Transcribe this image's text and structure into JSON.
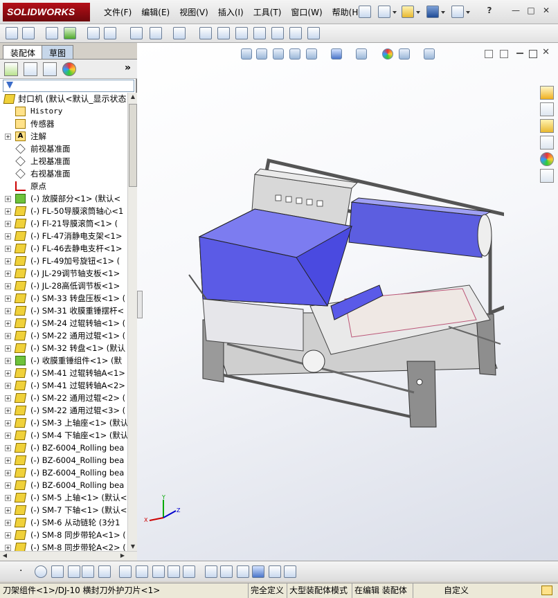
{
  "app": {
    "logo": "SOLIDWORKS",
    "brand_color": "#b50f18"
  },
  "menu": [
    "文件(F)",
    "编辑(E)",
    "视图(V)",
    "插入(I)",
    "工具(T)",
    "窗口(W)",
    "帮助(H)"
  ],
  "window_controls": {
    "help": "?",
    "minimize": "—",
    "restore": "□",
    "close": "✕"
  },
  "tabs": {
    "assembly": "装配体",
    "sketch": "草图"
  },
  "tree": {
    "root": "封口机 (默认<默认_显示状态",
    "items": [
      {
        "text": "History",
        "icon": "history-icon",
        "expand": false,
        "mono": true
      },
      {
        "text": "传感器",
        "icon": "sensor-icon",
        "expand": false
      },
      {
        "text": "注解",
        "icon": "annotation-icon",
        "expand": true
      },
      {
        "text": "前视基准面",
        "icon": "plane-icon",
        "expand": false
      },
      {
        "text": "上视基准面",
        "icon": "plane-icon",
        "expand": false
      },
      {
        "text": "右视基准面",
        "icon": "plane-icon",
        "expand": false
      },
      {
        "text": "原点",
        "icon": "origin-icon",
        "expand": false
      },
      {
        "text": "(-) 放膜部分<1> (默认<",
        "icon": "component-icon",
        "expand": true,
        "green": true
      },
      {
        "text": "(-) FL-50导膜滚筒轴心<1",
        "icon": "component-icon",
        "expand": true
      },
      {
        "text": "(-) Fl-21导膜滚筒<1> (",
        "icon": "component-icon",
        "expand": true
      },
      {
        "text": "(-) FL-47消静电支架<1>",
        "icon": "component-icon",
        "expand": true
      },
      {
        "text": "(-) FL-46去静电支杆<1>",
        "icon": "component-icon",
        "expand": true
      },
      {
        "text": "(-) FL-49加号旋钮<1> (",
        "icon": "component-icon",
        "expand": true
      },
      {
        "text": "(-) JL-29调节轴支板<1>",
        "icon": "component-icon",
        "expand": true
      },
      {
        "text": "(-) JL-28高低调节板<1>",
        "icon": "component-icon",
        "expand": true
      },
      {
        "text": "(-) SM-33 转盘压板<1> (",
        "icon": "component-icon",
        "expand": true
      },
      {
        "text": "(-) SM-31 收膜重锤摆杆<",
        "icon": "component-icon",
        "expand": true
      },
      {
        "text": "(-) SM-24 过辊转轴<1> (",
        "icon": "component-icon",
        "expand": true
      },
      {
        "text": "(-) SM-22 通用过辊<1> (",
        "icon": "component-icon",
        "expand": true
      },
      {
        "text": "(-) SM-32 转盘<1> (默认",
        "icon": "component-icon",
        "expand": true
      },
      {
        "text": "(-) 收膜重锤组件<1> (默",
        "icon": "component-icon",
        "expand": true,
        "green": true
      },
      {
        "text": "(-) SM-41 过辊转轴A<1>",
        "icon": "component-icon",
        "expand": true
      },
      {
        "text": "(-) SM-41 过辊转轴A<2>",
        "icon": "component-icon",
        "expand": true
      },
      {
        "text": "(-) SM-22 通用过辊<2> (",
        "icon": "component-icon",
        "expand": true
      },
      {
        "text": "(-) SM-22 通用过辊<3> (",
        "icon": "component-icon",
        "expand": true
      },
      {
        "text": "(-) SM-3 上轴座<1> (默认",
        "icon": "component-icon",
        "expand": true
      },
      {
        "text": "(-) SM-4 下轴座<1> (默认",
        "icon": "component-icon",
        "expand": true
      },
      {
        "text": "(-) BZ-6004_Rolling bea",
        "icon": "component-icon",
        "expand": true
      },
      {
        "text": "(-) BZ-6004_Rolling bea",
        "icon": "component-icon",
        "expand": true
      },
      {
        "text": "(-) BZ-6004_Rolling bea",
        "icon": "component-icon",
        "expand": true
      },
      {
        "text": "(-) BZ-6004_Rolling bea",
        "icon": "component-icon",
        "expand": true
      },
      {
        "text": "(-) SM-5 上轴<1> (默认<",
        "icon": "component-icon",
        "expand": true
      },
      {
        "text": "(-) SM-7 下轴<1> (默认<",
        "icon": "component-icon",
        "expand": true
      },
      {
        "text": "(-) SM-6 从动链轮 (3分1",
        "icon": "component-icon",
        "expand": true
      },
      {
        "text": "(-) SM-8 同步带轮A<1> (",
        "icon": "component-icon",
        "expand": true
      },
      {
        "text": "(-) SM-8 同步带轮A<2> (",
        "icon": "component-icon",
        "expand": true
      }
    ]
  },
  "model": {
    "machine_color": "#6a6ae8",
    "frame_color": "#8e8e8e"
  },
  "statusbar": {
    "selection": "刀架组件<1>/DJ-10 横封刀外护刀片<1>",
    "definition": "完全定义",
    "mode": "大型装配体模式",
    "editing": "在编辑 装配体",
    "units": "自定义"
  }
}
